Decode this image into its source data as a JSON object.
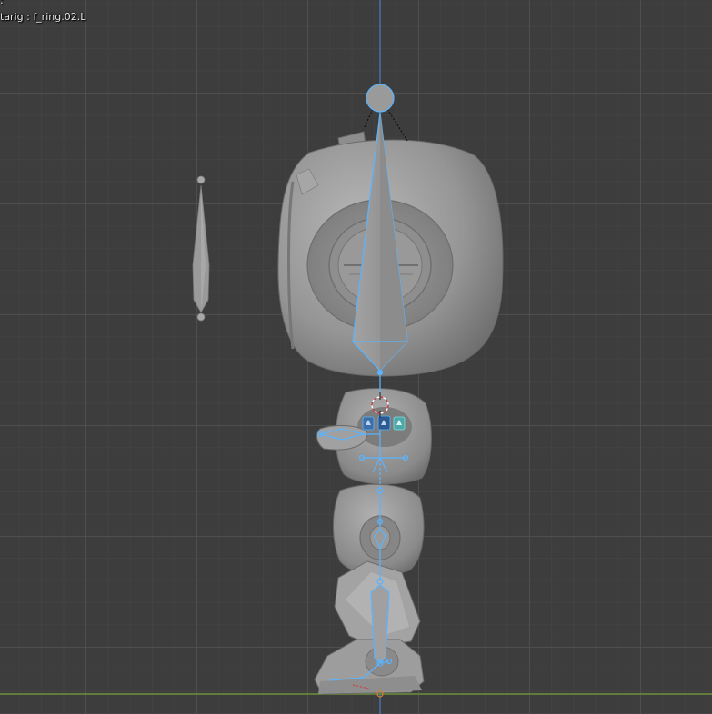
{
  "viewport": {
    "view_mode": ":",
    "active_object": "tarig : f_ring.02.L"
  },
  "colors": {
    "background": "#3d3d3d",
    "grid_major": "#505050",
    "grid_minor": "#464646",
    "z_axis": "#4a7fc4",
    "x_axis": "#6f8f3a",
    "mesh_light": "#b4b4b4",
    "mesh_mid": "#8a8a8a",
    "mesh_dark": "#5a5a5a",
    "bone_outline": "#5ab4ff",
    "bone_fill": "#9a9a9a",
    "widget_blue": "#3f6fa8",
    "widget_teal": "#4fa8a8",
    "cursor_red": "#d04040"
  },
  "icons": {
    "cursor": "3d-cursor-icon",
    "widgets": [
      "bone-widget-icon",
      "bone-widget-icon",
      "bone-widget-icon"
    ]
  }
}
